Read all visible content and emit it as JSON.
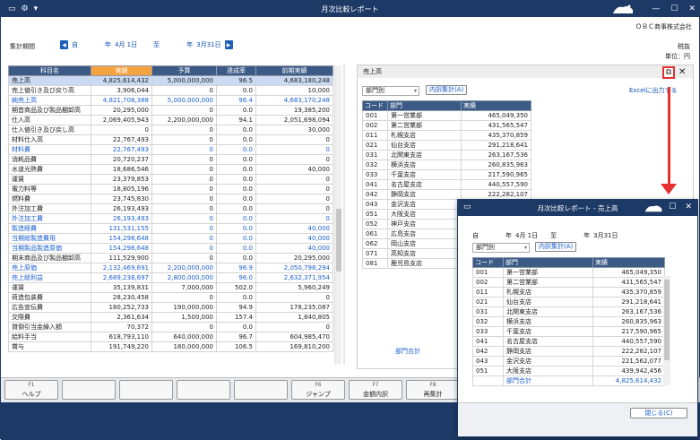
{
  "window": {
    "title": "月次比較レポート",
    "company": "ＯＢＣ商事株式会社"
  },
  "period": {
    "label": "集計期間",
    "from_prefix": "自",
    "from_year": "年",
    "from_date": "4月 1日",
    "to_prefix": "至",
    "to_year": "年",
    "to_date": "3月31日"
  },
  "right_info": {
    "tax": "税抜",
    "unit": "単位：円"
  },
  "main_table": {
    "headers": [
      "科目名",
      "実績",
      "予算",
      "達成率",
      "前期実績"
    ],
    "rows": [
      [
        "売上高",
        "4,825,614,432",
        "5,000,000,000",
        "96.5",
        "4,683,180,248"
      ],
      [
        "売上値引き及び戻り高",
        "3,906,044",
        "0",
        "0.0",
        "10,000"
      ],
      [
        "純売上高",
        "4,821,708,388",
        "5,000,000,000",
        "96.4",
        "4,683,170,248"
      ],
      [
        "期首商品及び製品棚卸高",
        "20,295,000",
        "0",
        "0.0",
        "19,385,200"
      ],
      [
        "仕入高",
        "2,069,405,943",
        "2,200,000,000",
        "94.1",
        "2,051,698,094"
      ],
      [
        "仕入値引き及び戻し高",
        "0",
        "0",
        "0.0",
        "30,000"
      ],
      [
        "材料仕入高",
        "22,767,493",
        "0",
        "0.0",
        "0"
      ],
      [
        "材料費",
        "22,767,493",
        "0",
        "0.0",
        "0"
      ],
      [
        "消耗品費",
        "20,720,237",
        "0",
        "0.0",
        "0"
      ],
      [
        "水道光熱費",
        "18,686,546",
        "0",
        "0.0",
        "40,000"
      ],
      [
        "運賃",
        "23,379,853",
        "0",
        "0.0",
        "0"
      ],
      [
        "電力料等",
        "18,805,196",
        "0",
        "0.0",
        "0"
      ],
      [
        "燃料費",
        "23,745,830",
        "0",
        "0.0",
        "0"
      ],
      [
        "外注加工費",
        "26,193,493",
        "0",
        "0.0",
        "0"
      ],
      [
        "外注加工費",
        "26,193,493",
        "0",
        "0.0",
        "0"
      ],
      [
        "製造経費",
        "131,531,155",
        "0",
        "0.0",
        "40,000"
      ],
      [
        "当期総製造費用",
        "154,298,648",
        "0",
        "0.0",
        "40,000"
      ],
      [
        "当期製品製造原価",
        "154,298,648",
        "0",
        "0.0",
        "40,000"
      ],
      [
        "期末商品及び製品棚卸高",
        "111,529,900",
        "0",
        "0.0",
        "20,295,000"
      ],
      [
        "売上原価",
        "2,132,469,691",
        "2,200,000,000",
        "96.9",
        "2,050,798,294"
      ],
      [
        "売上総利益",
        "2,689,238,697",
        "2,800,000,000",
        "96.0",
        "2,632,371,954"
      ],
      [
        "運賃",
        "35,139,831",
        "7,000,000",
        "502.0",
        "5,960,249"
      ],
      [
        "荷造包装費",
        "28,230,458",
        "0",
        "0.0",
        "0"
      ],
      [
        "広告宣伝費",
        "180,252,733",
        "190,000,000",
        "94.9",
        "178,235,087"
      ],
      [
        "交際費",
        "2,361,634",
        "1,500,000",
        "157.4",
        "1,840,805"
      ],
      [
        "貸倒引当金繰入額",
        "70,372",
        "0",
        "0.0",
        "0"
      ],
      [
        "給料手当",
        "618,793,110",
        "640,000,000",
        "96.7",
        "604,985,470"
      ],
      [
        "賞与",
        "191,749,220",
        "180,000,000",
        "106.5",
        "169,810,200"
      ]
    ]
  },
  "right_panel": {
    "header": "売上高",
    "select_value": "部門別",
    "breakdown_button": "内訳集計(A)",
    "excel_link": "Excelに出力する",
    "columns": [
      "コード",
      "部門",
      "実績"
    ],
    "rows": [
      [
        "001",
        "第一営業部",
        "465,049,350"
      ],
      [
        "002",
        "第二営業部",
        "431,565,547"
      ],
      [
        "011",
        "札幌支店",
        "435,370,859"
      ],
      [
        "021",
        "仙台支店",
        "291,218,641"
      ],
      [
        "031",
        "北関東支店",
        "263,167,536"
      ],
      [
        "032",
        "横浜支店",
        "260,835,963"
      ],
      [
        "033",
        "千葉支店",
        "217,590,965"
      ],
      [
        "041",
        "名古屋支店",
        "440,557,590"
      ],
      [
        "042",
        "静岡支店",
        "222,282,107"
      ],
      [
        "043",
        "金沢支店",
        ""
      ],
      [
        "051",
        "大阪支店",
        ""
      ],
      [
        "052",
        "神戸支店",
        ""
      ],
      [
        "061",
        "広島支店",
        ""
      ],
      [
        "062",
        "岡山支店",
        ""
      ],
      [
        "071",
        "高知支店",
        ""
      ],
      [
        "081",
        "鹿児島支店",
        ""
      ]
    ],
    "total_label": "部門合計"
  },
  "function_keys": [
    {
      "key": "F1",
      "label": "ヘルプ"
    },
    {
      "key": "",
      "label": ""
    },
    {
      "key": "",
      "label": ""
    },
    {
      "key": "",
      "label": ""
    },
    {
      "key": "",
      "label": ""
    },
    {
      "key": "F6",
      "label": "ジャンプ"
    },
    {
      "key": "F7",
      "label": "金額内訳"
    },
    {
      "key": "F8",
      "label": "再集計"
    }
  ],
  "popup": {
    "title": "月次比較レポート - 売上高",
    "year": "年",
    "from_date": "4月 1日",
    "to_prefix": "至",
    "to_date": "3月31日",
    "select_value": "部門別",
    "breakdown_button": "内訳集計(A)",
    "columns": [
      "コード",
      "部門",
      "実績"
    ],
    "rows": [
      [
        "001",
        "第一営業部",
        "465,049,350"
      ],
      [
        "002",
        "第二営業部",
        "431,565,547"
      ],
      [
        "011",
        "札幌支店",
        "435,370,859"
      ],
      [
        "021",
        "仙台支店",
        "291,218,641"
      ],
      [
        "031",
        "北関東支店",
        "263,167,536"
      ],
      [
        "032",
        "横浜支店",
        "260,835,963"
      ],
      [
        "033",
        "千葉支店",
        "217,590,965"
      ],
      [
        "041",
        "名古屋支店",
        "440,557,590"
      ],
      [
        "042",
        "静岡支店",
        "222,282,107"
      ],
      [
        "043",
        "金沢支店",
        "221,562,077"
      ],
      [
        "051",
        "大阪支店",
        "439,942,456"
      ]
    ],
    "total_label": "部門合計",
    "total_value": "4,825,614,432",
    "close_button": "閉じる(C)"
  },
  "colors": {
    "titlebar": "#1d3a66",
    "header": "#3b5b86",
    "selected_header": "#f5a340",
    "highlight_row": "#c9daf2",
    "link": "#1a5fd0",
    "annotation": "#e53030"
  }
}
